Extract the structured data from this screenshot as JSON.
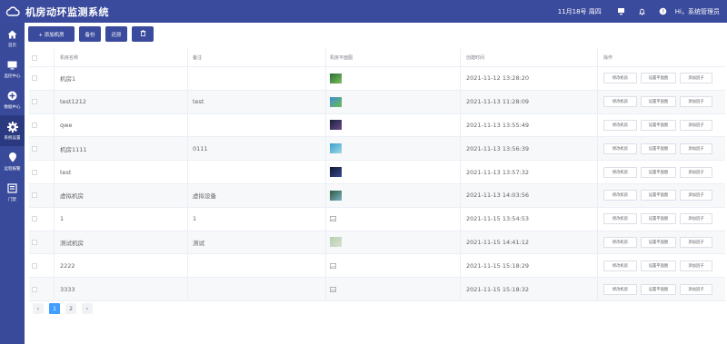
{
  "header": {
    "title": "机房动环监测系统",
    "date": "11月18号 周四",
    "user": "Hi，系统管理员"
  },
  "sidebar": {
    "items": [
      {
        "label": "首页",
        "icon": "home-icon"
      },
      {
        "label": "监控中心",
        "icon": "monitor-icon"
      },
      {
        "label": "数据中心",
        "icon": "data-icon"
      },
      {
        "label": "系统设置",
        "icon": "gear-icon",
        "active": true
      },
      {
        "label": "远程报警",
        "icon": "alarm-icon"
      },
      {
        "label": "门禁",
        "icon": "door-icon"
      }
    ]
  },
  "toolbar": {
    "add_label": "+ 添加机房",
    "backup_label": "备份",
    "restore_label": "还原",
    "delete_label": "🗑"
  },
  "table": {
    "headers": {
      "name": "机房名称",
      "note": "备注",
      "image": "机房平面图",
      "time": "创建时间",
      "op": "操作"
    },
    "op_labels": {
      "edit": "修改机房",
      "set_plan": "设置平面图",
      "add_factor": "添加因子"
    },
    "rows": [
      {
        "name": "机房1",
        "note": "",
        "image": "photo",
        "time": "2021-11-12 13:28:20"
      },
      {
        "name": "test1212",
        "note": "test",
        "image": "photo",
        "time": "2021-11-13 11:28:09"
      },
      {
        "name": "qwe",
        "note": "",
        "image": "photo",
        "time": "2021-11-13 13:55:49"
      },
      {
        "name": "机房1111",
        "note": "0111",
        "image": "photo",
        "time": "2021-11-13 13:56:39"
      },
      {
        "name": "test",
        "note": "",
        "image": "photo",
        "time": "2021-11-13 13:57:32"
      },
      {
        "name": "虚拟机房",
        "note": "虚拟设备",
        "image": "photo",
        "time": "2021-11-13 14:03:56"
      },
      {
        "name": "1",
        "note": "1",
        "image": "placeholder",
        "time": "2021-11-15 13:54:53"
      },
      {
        "name": "测试机房",
        "note": "测试",
        "image": "photo",
        "time": "2021-11-15 14:41:12"
      },
      {
        "name": "2222",
        "note": "",
        "image": "placeholder",
        "time": "2021-11-15 15:18:29"
      },
      {
        "name": "3333",
        "note": "",
        "image": "placeholder",
        "time": "2021-11-15 15:18:32"
      }
    ]
  },
  "pagination": {
    "prev": "‹",
    "pages": [
      "1",
      "2"
    ],
    "current": "1",
    "next": "›"
  },
  "colors": {
    "header_bg": "#3a4a9c",
    "sidebar_bg": "#394a9b",
    "accent": "#409eff"
  }
}
